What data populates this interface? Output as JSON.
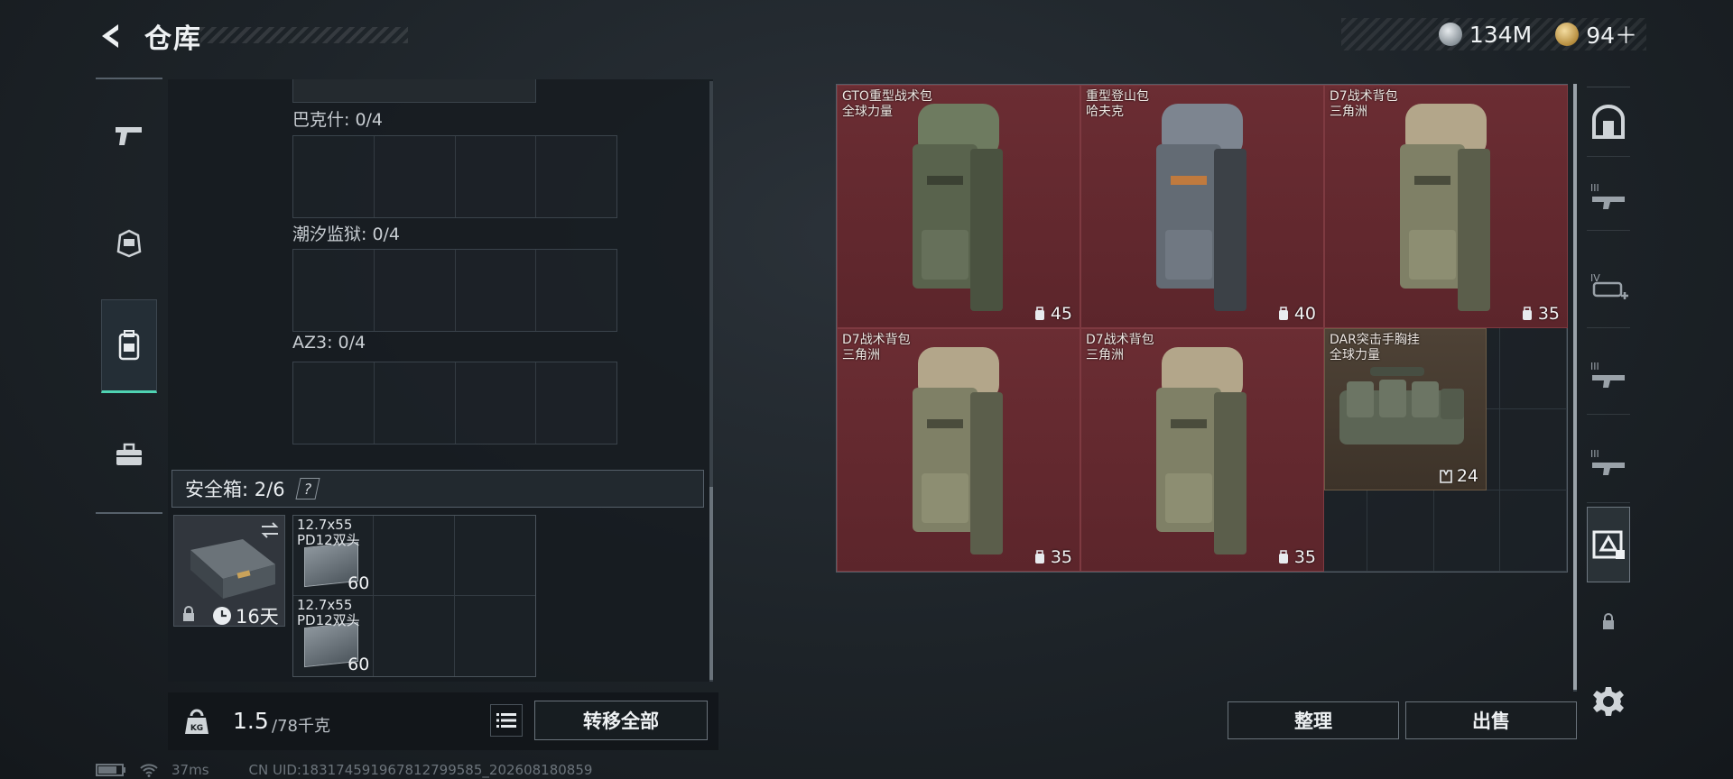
{
  "header": {
    "title": "仓库",
    "currencies": [
      {
        "icon": "silver-coin-icon",
        "value": "134M",
        "color": "#a9b1b8"
      },
      {
        "icon": "gold-coin-icon",
        "value": "94＋",
        "color": "#c9a45a"
      }
    ]
  },
  "left_rail": {
    "items": [
      {
        "name": "weapons",
        "icon": "pistol-icon"
      },
      {
        "name": "equipment",
        "icon": "helmet-icon"
      },
      {
        "name": "backpacks",
        "icon": "backpack-icon",
        "active": true
      },
      {
        "name": "tools",
        "icon": "toolbox-icon"
      }
    ]
  },
  "left_panel": {
    "containers": [
      {
        "label": "巴克什: 0/4"
      },
      {
        "label": "潮汐监狱: 0/4"
      },
      {
        "label": "AZ3: 0/4"
      }
    ],
    "safe": {
      "label": "安全箱:",
      "count": "2/6",
      "help": "?",
      "timer": "16天",
      "items": [
        {
          "name": "12.7x55\nPD12双头",
          "count": "60"
        },
        {
          "name": "12.7x55\nPD12双头",
          "count": "60"
        }
      ]
    },
    "weight": {
      "current": "1.5",
      "max": "/78千克",
      "icon_label": "KG"
    },
    "transfer_all_label": "转移全部"
  },
  "stash": {
    "items": [
      {
        "name": "GTO重型战术包\n全球力量",
        "capacity": "45",
        "bg": "red",
        "tint": "#6e7b60"
      },
      {
        "name": "重型登山包\n哈夫克",
        "capacity": "40",
        "bg": "red",
        "tint": "#7d8590"
      },
      {
        "name": "D7战术背包\n三角洲",
        "capacity": "35",
        "bg": "red",
        "tint": "#b3a68a"
      },
      {
        "name": "D7战术背包\n三角洲",
        "capacity": "35",
        "bg": "red",
        "tint": "#b3a68a"
      },
      {
        "name": "D7战术背包\n三角洲",
        "capacity": "35",
        "bg": "red",
        "tint": "#b3a68a"
      },
      {
        "name": "DAR突击手胸挂\n全球力量",
        "capacity": "24",
        "bg": "gold",
        "tint": "#6c7564"
      }
    ],
    "sort_label": "整理",
    "sell_label": "出售"
  },
  "right_rail": {
    "items": [
      {
        "icon": "vault-icon"
      },
      {
        "icon": "tier3-weapon-icon"
      },
      {
        "icon": "tier4-weapon-add-icon"
      },
      {
        "icon": "tier3-weapon-icon"
      },
      {
        "icon": "tier3-weapon-icon"
      },
      {
        "icon": "stash-filter-icon",
        "active": true
      },
      {
        "icon": "lock-icon"
      },
      {
        "icon": "settings-gear-icon"
      }
    ]
  },
  "status": {
    "ping": "37ms",
    "uid": "CN UID:1831745919678127995​85_202608180859"
  }
}
